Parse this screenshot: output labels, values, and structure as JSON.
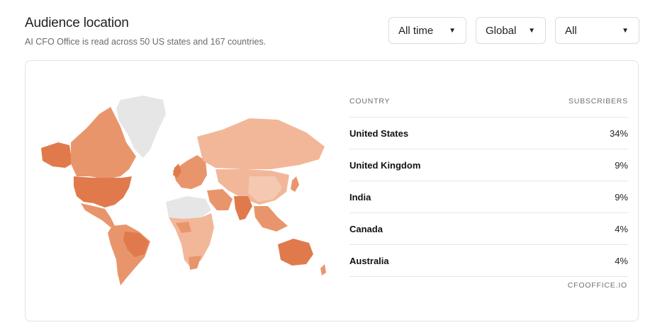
{
  "header": {
    "title": "Audience location",
    "subtitle": "AI CFO Office is read across 50 US states and 167 countries."
  },
  "filters": {
    "time": "All time",
    "region": "Global",
    "segment": "All"
  },
  "table": {
    "col_country": "COUNTRY",
    "col_subscribers": "SUBSCRIBERS",
    "rows": [
      {
        "country": "United States",
        "value": "34%"
      },
      {
        "country": "United Kingdom",
        "value": "9%"
      },
      {
        "country": "India",
        "value": "9%"
      },
      {
        "country": "Canada",
        "value": "4%"
      },
      {
        "country": "Australia",
        "value": "4%"
      }
    ]
  },
  "footer": "CFOOFFICE.IO",
  "colors": {
    "strong": "#e07a4c",
    "medium": "#e9956c",
    "light": "#f2b799",
    "lighter": "#f5c9b1",
    "none": "#e6e6e6"
  }
}
